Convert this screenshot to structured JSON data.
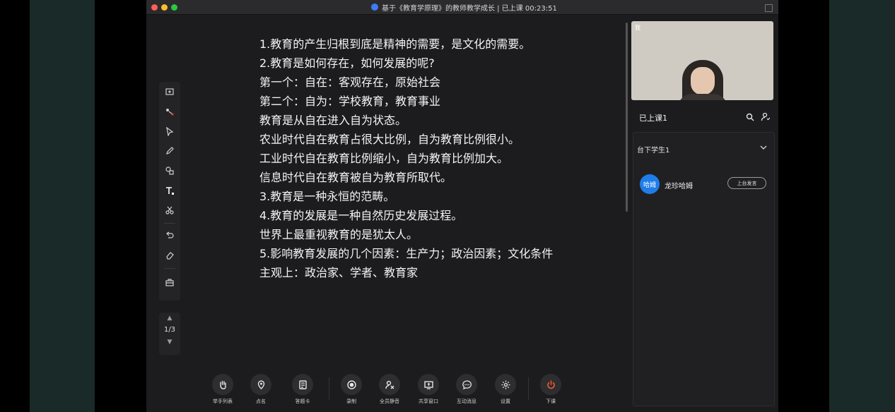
{
  "window": {
    "title": "基于《教育学原理》的教师教学成长 | 已上课 00:23:51"
  },
  "board": {
    "lines": [
      "1.教育的产生归根到底是精神的需要，是文化的需要。",
      "2.教育是如何存在，如何发展的呢?",
      "第一个：自在：客观存在，原始社会",
      "第二个：自为：学校教育，教育事业",
      "教育是从自在进入自为状态。",
      "农业时代自在教育占很大比例，自为教育比例很小。",
      "工业时代自在教育比例缩小，自为教育比例加大。",
      "信息时代自在教育被自为教育所取代。",
      "3.教育是一种永恒的范畴。",
      "4.教育的发展是一种自然历史发展过程。",
      "世界上最重视教育的是犹太人。",
      "5.影响教育发展的几个因素：生产力；政治因素；文化条件",
      "主观上：政治家、学者、教育家"
    ]
  },
  "tools": [
    {
      "icon": "import-file-icon"
    },
    {
      "icon": "laser-pointer-icon"
    },
    {
      "icon": "select-arrow-icon"
    },
    {
      "icon": "pen-icon"
    },
    {
      "icon": "shapes-icon"
    },
    {
      "icon": "text-icon"
    },
    {
      "icon": "scissors-icon"
    },
    {
      "icon": "undo-icon"
    },
    {
      "icon": "eraser-icon"
    },
    {
      "icon": "toolbox-icon"
    }
  ],
  "pager": {
    "page": "1/3"
  },
  "toolbar": {
    "raise_hand": "举手列表",
    "roll_call": "点名",
    "answer_card": "答题卡",
    "record": "录制",
    "mute_all": "全员静音",
    "share_window": "共享窗口",
    "interactive_messages": "互动消息",
    "settings": "设置",
    "end_class": "下课"
  },
  "video": {
    "tag": "我"
  },
  "room": {
    "title": "已上课1",
    "group_title": "台下学生1",
    "students": [
      {
        "avatar_text": "哈姆",
        "name": "龙珍哈姆",
        "action": "上台发言"
      }
    ]
  },
  "colors": {
    "accent_blue": "#1f7de8",
    "end_class_red": "#ff5a2c",
    "window_bg": "#1c1c1e"
  }
}
